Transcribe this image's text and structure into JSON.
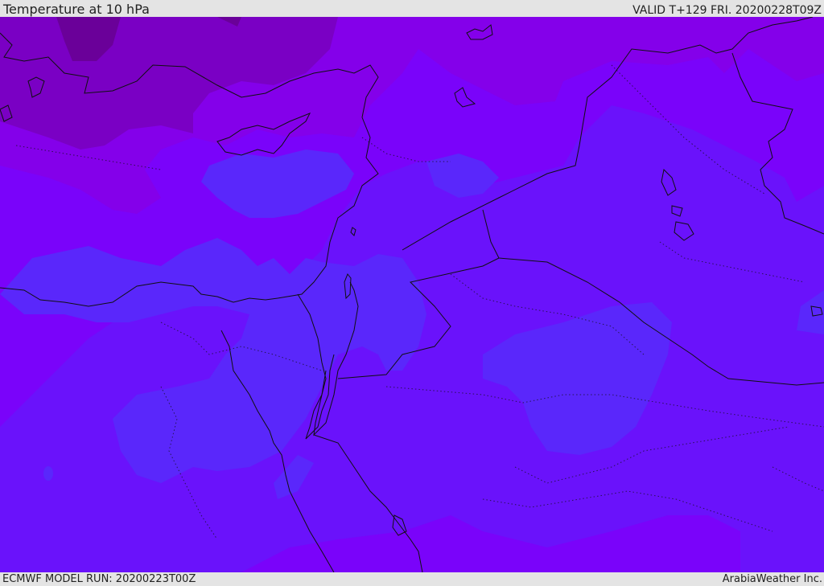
{
  "header": {
    "title": "Temperature at 10 hPa",
    "valid": "VALID T+129 FRI. 20200228T09Z"
  },
  "footer": {
    "model_run": "ECMWF MODEL RUN: 20200223T00Z",
    "credit": "ArabiaWeather Inc."
  },
  "colors": {
    "band_warmest": "#5a27fb",
    "band_warm": "#6a12fb",
    "band_mid": "#7a03fa",
    "band_cool": "#8400ea",
    "band_cold": "#7a00c4",
    "band_coldest": "#6a0099",
    "coastline": "#101010"
  }
}
